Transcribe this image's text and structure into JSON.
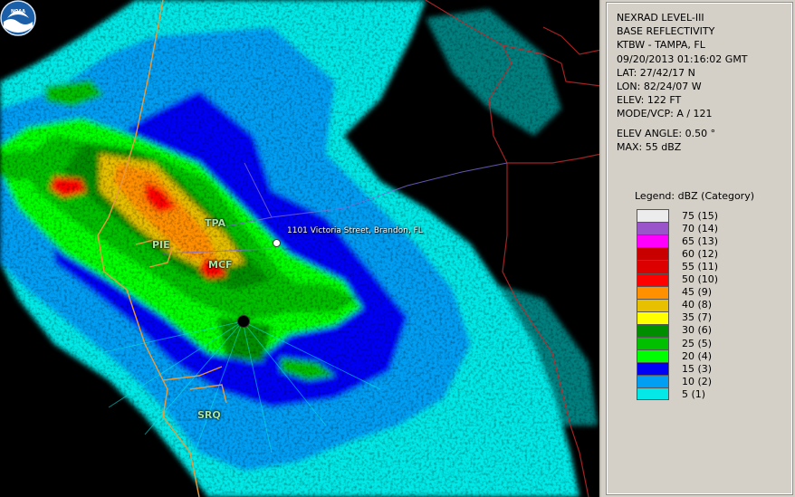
{
  "info": {
    "product": "NEXRAD LEVEL-III",
    "type": "BASE REFLECTIVITY",
    "station": "KTBW - TAMPA, FL",
    "datetime": "09/20/2013 01:16:02 GMT",
    "lat": "LAT: 27/42/17 N",
    "lon": "LON: 82/24/07 W",
    "elev": "ELEV: 122 FT",
    "mode": "MODE/VCP: A / 121",
    "elev_angle": "ELEV ANGLE: 0.50 °",
    "max": "MAX: 55 dBZ"
  },
  "legend": {
    "title": "Legend: dBZ (Category)",
    "items": [
      {
        "label": "75  (15)",
        "color": "#ececec"
      },
      {
        "label": "70  (14)",
        "color": "#9955c9"
      },
      {
        "label": "65  (13)",
        "color": "#ff00ff"
      },
      {
        "label": "60  (12)",
        "color": "#c80000"
      },
      {
        "label": "55  (11)",
        "color": "#dd0000"
      },
      {
        "label": "50  (10)",
        "color": "#ff0000"
      },
      {
        "label": "45  (9)",
        "color": "#ff9000"
      },
      {
        "label": "40  (8)",
        "color": "#e7c000"
      },
      {
        "label": "35  (7)",
        "color": "#ffff00"
      },
      {
        "label": "30  (6)",
        "color": "#008e00"
      },
      {
        "label": "25  (5)",
        "color": "#00c000"
      },
      {
        "label": "20  (4)",
        "color": "#00ff00"
      },
      {
        "label": "15  (3)",
        "color": "#0000f6"
      },
      {
        "label": "10  (2)",
        "color": "#019ff4"
      },
      {
        "label": "5  (1)",
        "color": "#04e9e7"
      }
    ]
  },
  "map": {
    "address": "1101 Victoria Street, Brandon, FL",
    "labels": {
      "tpa": "TPA",
      "pie": "PIE",
      "mcf": "MCF",
      "srq": "SRQ"
    }
  },
  "logo": "NOAA"
}
